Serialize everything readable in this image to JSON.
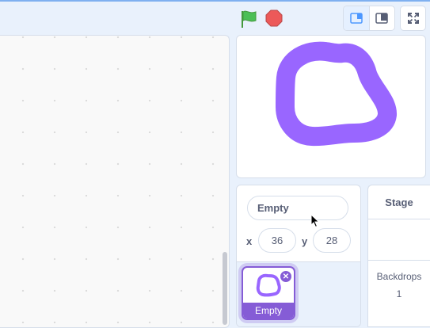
{
  "controls": {
    "flag_icon": "green-flag-icon",
    "stop_icon": "stop-icon",
    "flag_color": "#4cbf56",
    "stop_color": "#ec5959"
  },
  "sprite_info": {
    "name": "Empty",
    "x_label": "x",
    "x_value": "36",
    "y_label": "y",
    "y_value": "28"
  },
  "sprite_list": {
    "items": [
      {
        "name": "Empty",
        "selected": true
      }
    ]
  },
  "stage_selector": {
    "title": "Stage",
    "backdrops_label": "Backdrops",
    "backdrops_count": "1"
  },
  "colors": {
    "accent": "#855cd6",
    "sprite_stroke": "#9966ff",
    "background": "#e9f1fc"
  }
}
